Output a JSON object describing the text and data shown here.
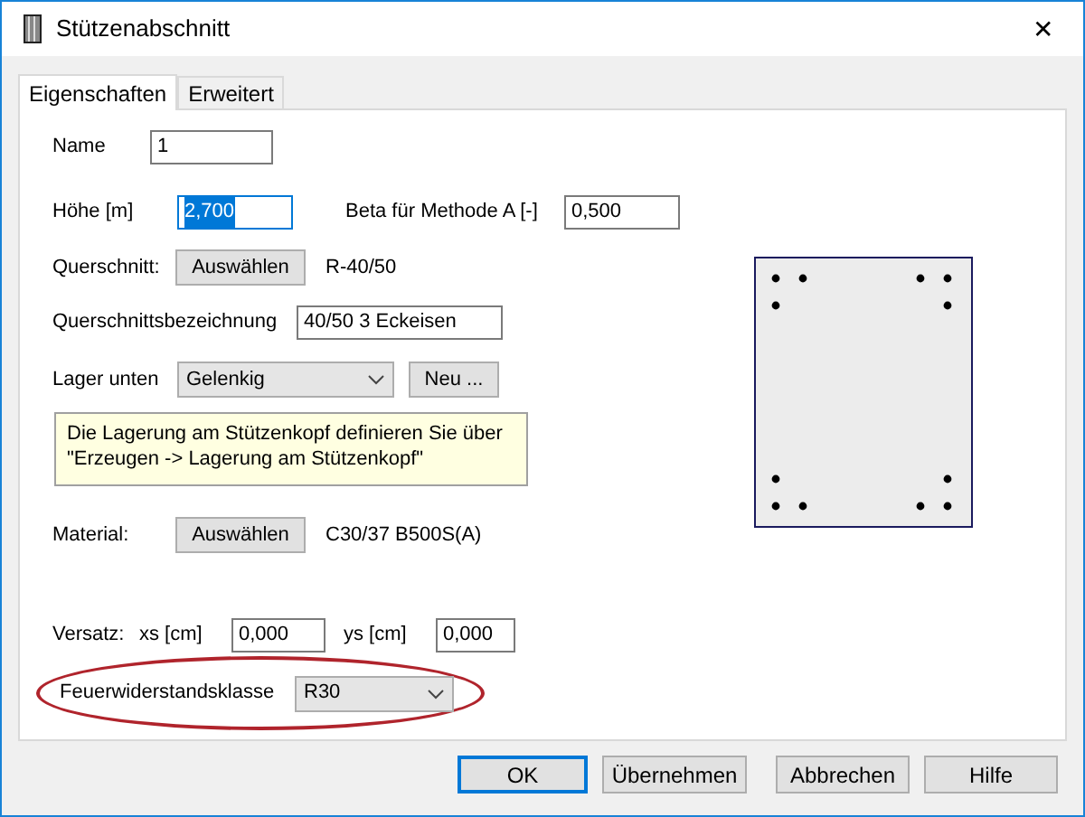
{
  "window": {
    "title": "Stützenabschnitt",
    "close": "✕"
  },
  "tabs": [
    {
      "label": "Eigenschaften",
      "selected": true
    },
    {
      "label": "Erweitert",
      "selected": false
    }
  ],
  "form": {
    "name": {
      "label": "Name",
      "value": "1"
    },
    "hoehe": {
      "label": "Höhe [m]",
      "value": "2,700",
      "selected": true
    },
    "beta": {
      "label": "Beta für Methode A [-]",
      "value": "0,500"
    },
    "querschnitt": {
      "label": "Querschnitt:",
      "button": "Auswählen",
      "value": "R-40/50"
    },
    "bezeichnung": {
      "label": "Querschnittsbezeichnung",
      "value": "40/50 3 Eckeisen"
    },
    "lager": {
      "label": "Lager unten",
      "value": "Gelenkig",
      "button": "Neu ..."
    },
    "hint": "Die Lagerung am Stützenkopf definieren Sie über \"Erzeugen -> Lagerung am Stützenkopf\"",
    "material": {
      "label": "Material:",
      "button": "Auswählen",
      "value": "C30/37 B500S(A)"
    },
    "versatz": {
      "label": "Versatz:",
      "xs_label": "xs [cm]",
      "xs": "0,000",
      "ys_label": "ys [cm]",
      "ys": "0,000"
    },
    "feuer": {
      "label": "Feuerwiderstandsklasse",
      "value": "R30",
      "highlighted": true
    }
  },
  "buttons": [
    {
      "label": "OK",
      "default": true
    },
    {
      "label": "Übernehmen",
      "default": false
    },
    {
      "label": "Abbrechen",
      "default": false
    },
    {
      "label": "Hilfe",
      "default": false
    }
  ]
}
